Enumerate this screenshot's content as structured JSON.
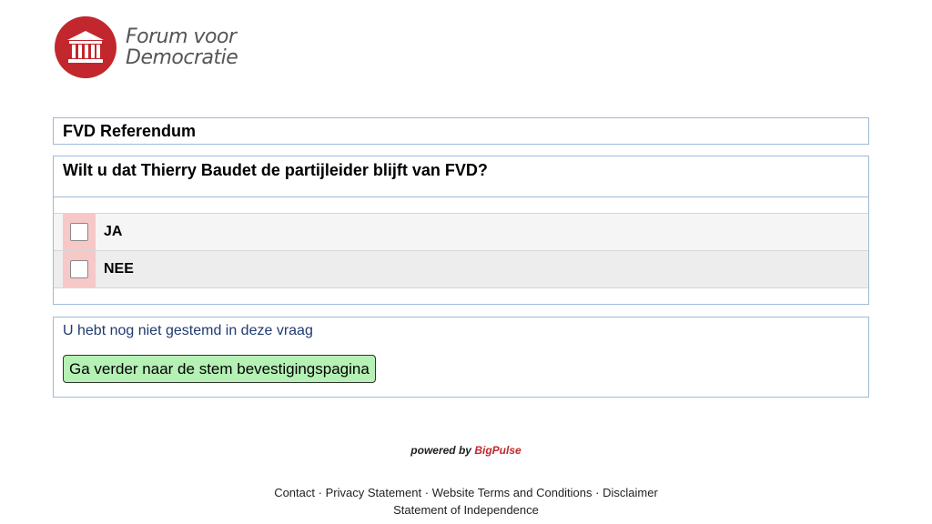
{
  "logo": {
    "line1": "Forum voor",
    "line2": "Democratie",
    "icon": "temple-icon",
    "color": "#c1272d"
  },
  "ballot": {
    "title": "FVD Referendum",
    "question": "Wilt u dat Thierry Baudet de partijleider blijft van FVD?",
    "options": [
      {
        "label": "JA",
        "checked": false
      },
      {
        "label": "NEE",
        "checked": false
      }
    ]
  },
  "status": {
    "message": "U hebt nog niet gestemd in deze vraag",
    "continue_label": "Ga verder naar de stem bevestigingspagina"
  },
  "powered_by": {
    "prefix": "powered by",
    "brand": "BigPulse"
  },
  "footer": {
    "links": [
      "Contact",
      "Privacy Statement",
      "Website Terms and Conditions",
      "Disclaimer"
    ],
    "separator": "·",
    "line2": "Statement of Independence"
  }
}
